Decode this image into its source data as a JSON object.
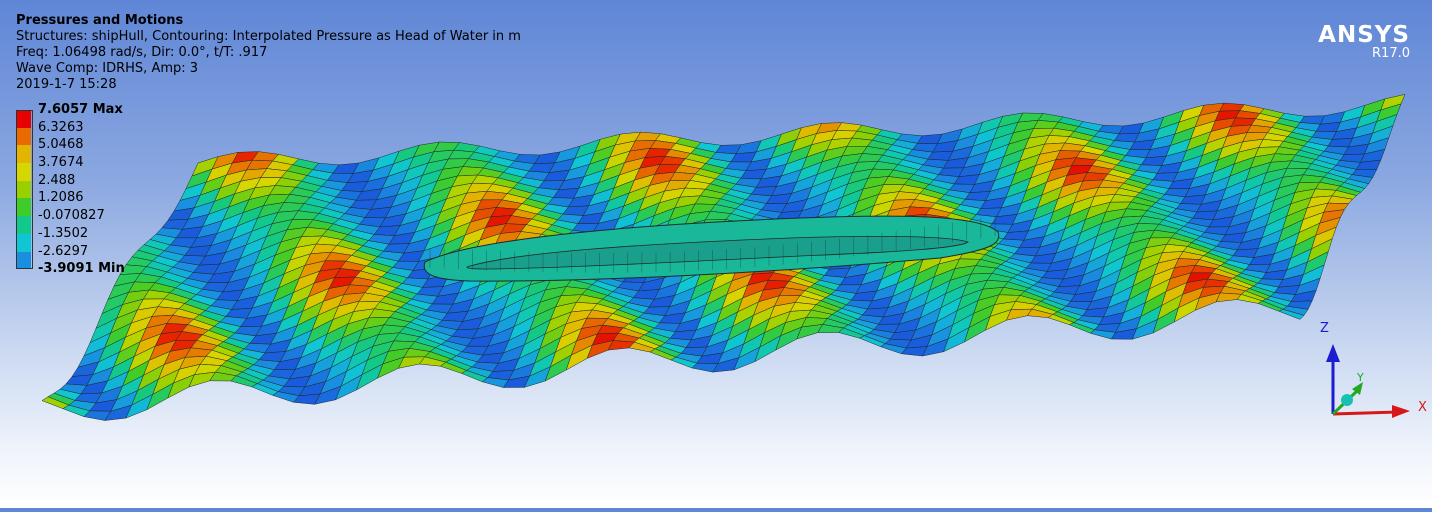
{
  "header": {
    "title": "Pressures and Motions",
    "lines": [
      "Structures: shipHull, Contouring: Interpolated Pressure as Head of Water in m",
      "Freq: 1.06498 rad/s, Dir: 0.0°, t/T: .917",
      "Wave Comp: IDRHS, Amp: 3",
      "2019-1-7 15:28"
    ]
  },
  "legend": {
    "entries": [
      {
        "label": "7.6057 Max",
        "color": "#e60000",
        "bold": true
      },
      {
        "label": "6.3263",
        "color": "#e86a00",
        "bold": false
      },
      {
        "label": "5.0468",
        "color": "#e3b400",
        "bold": false
      },
      {
        "label": "3.7674",
        "color": "#d6d600",
        "bold": false
      },
      {
        "label": "2.488",
        "color": "#9ad000",
        "bold": false
      },
      {
        "label": "1.2086",
        "color": "#3fcc2a",
        "bold": false
      },
      {
        "label": "-0.070827",
        "color": "#12c88a",
        "bold": false
      },
      {
        "label": "-1.3502",
        "color": "#10c6d4",
        "bold": false
      },
      {
        "label": "-2.6297",
        "color": "#1a8fe0",
        "bold": false
      },
      {
        "label": "-3.9091 Min",
        "color": "#1a2fd8",
        "bold": true
      }
    ]
  },
  "brand": {
    "name": "ANSYS",
    "version": "R17.0"
  },
  "triad": {
    "z_label": "Z",
    "x_label": "X",
    "y_label": "Y"
  },
  "colors": {
    "hull": "#19b89a",
    "mesh_line": "#1c2a2a"
  }
}
